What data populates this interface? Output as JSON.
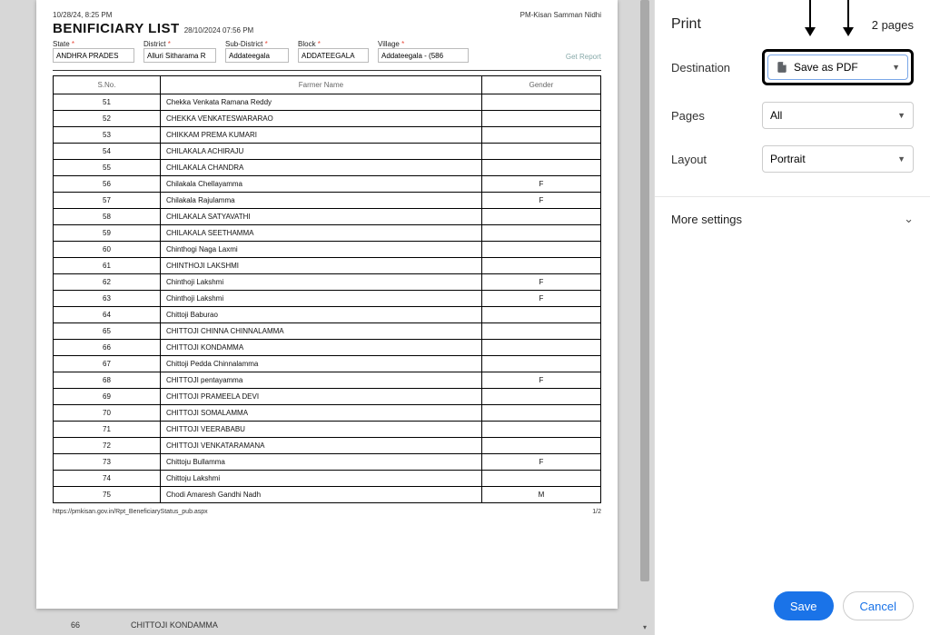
{
  "preview": {
    "header_left": "10/28/24, 8:25 PM",
    "header_right": "PM-Kisan Samman Nidhi",
    "title": "BENIFICIARY LIST",
    "title_ts": "28/10/2024 07:56 PM",
    "filters": {
      "state_label": "State",
      "state_val": "ANDHRA PRADES",
      "district_label": "District",
      "district_val": "Alluri Sitharama R",
      "sub_label": "Sub-District",
      "sub_val": "Addateegala",
      "block_label": "Block",
      "block_val": "ADDATEEGALA",
      "village_label": "Village",
      "village_val": "Addateegala - (586",
      "get_report": "Get Report"
    },
    "columns": {
      "sno": "S.No.",
      "name": "Farmer Name",
      "gender": "Gender"
    },
    "footer_url": "https://pmkisan.gov.in/Rpt_BeneficiaryStatus_pub.aspx",
    "footer_page": "1/2",
    "under_sn": "66",
    "under_name": "CHITTOJI KONDAMMA"
  },
  "chart_data": {
    "type": "table",
    "columns": [
      "S.No.",
      "Farmer Name",
      "Gender"
    ],
    "rows": [
      {
        "sno": "51",
        "name": "Chekka Venkata Ramana Reddy",
        "gender": ""
      },
      {
        "sno": "52",
        "name": "CHEKKA VENKATESWARARAO",
        "gender": ""
      },
      {
        "sno": "53",
        "name": "CHIKKAM PREMA KUMARI",
        "gender": ""
      },
      {
        "sno": "54",
        "name": "CHILAKALA ACHIRAJU",
        "gender": ""
      },
      {
        "sno": "55",
        "name": "CHILAKALA CHANDRA",
        "gender": ""
      },
      {
        "sno": "56",
        "name": "Chilakala Chellayamma",
        "gender": "F"
      },
      {
        "sno": "57",
        "name": "Chilakala Rajulamma",
        "gender": "F"
      },
      {
        "sno": "58",
        "name": "CHILAKALA SATYAVATHI",
        "gender": ""
      },
      {
        "sno": "59",
        "name": "CHILAKALA SEETHAMMA",
        "gender": ""
      },
      {
        "sno": "60",
        "name": "Chinthogi Naga Laxmi",
        "gender": ""
      },
      {
        "sno": "61",
        "name": "CHINTHOJI LAKSHMI",
        "gender": ""
      },
      {
        "sno": "62",
        "name": "Chinthoji Lakshmi",
        "gender": "F"
      },
      {
        "sno": "63",
        "name": "Chinthoji Lakshmi",
        "gender": "F"
      },
      {
        "sno": "64",
        "name": "Chittoji Baburao",
        "gender": ""
      },
      {
        "sno": "65",
        "name": "CHITTOJI CHINNA CHINNALAMMA",
        "gender": ""
      },
      {
        "sno": "66",
        "name": "CHITTOJI KONDAMMA",
        "gender": ""
      },
      {
        "sno": "67",
        "name": "Chittoji Pedda Chinnalamma",
        "gender": ""
      },
      {
        "sno": "68",
        "name": "CHITTOJI pentayamma",
        "gender": "F"
      },
      {
        "sno": "69",
        "name": "CHITTOJI PRAMEELA DEVI",
        "gender": ""
      },
      {
        "sno": "70",
        "name": "CHITTOJI SOMALAMMA",
        "gender": ""
      },
      {
        "sno": "71",
        "name": "CHITTOJI VEERABABU",
        "gender": ""
      },
      {
        "sno": "72",
        "name": "CHITTOJI VENKATARAMANA",
        "gender": ""
      },
      {
        "sno": "73",
        "name": "Chittoju Bullamma",
        "gender": "F"
      },
      {
        "sno": "74",
        "name": "Chittoju Lakshmi",
        "gender": ""
      },
      {
        "sno": "75",
        "name": "Chodi Amaresh Gandhi Nadh",
        "gender": "M"
      }
    ]
  },
  "side": {
    "title": "Print",
    "pages": "2 pages",
    "dest_label": "Destination",
    "dest_value": "Save as PDF",
    "pages_label": "Pages",
    "pages_value": "All",
    "layout_label": "Layout",
    "layout_value": "Portrait",
    "more": "More settings",
    "save": "Save",
    "cancel": "Cancel"
  }
}
